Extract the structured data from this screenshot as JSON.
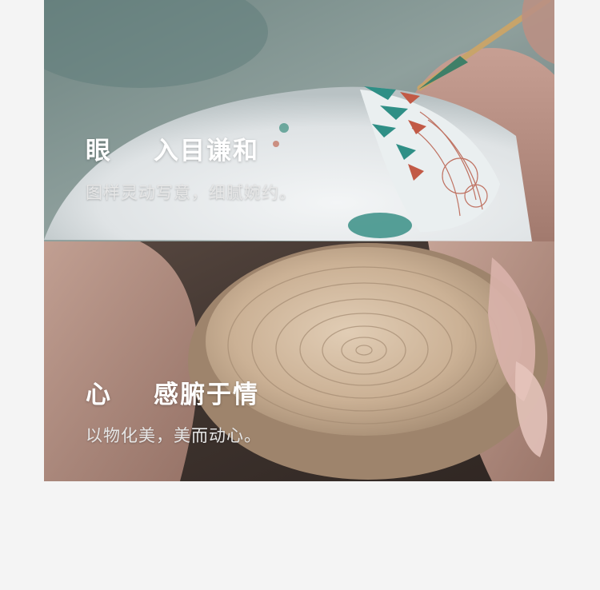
{
  "sections": [
    {
      "heading_char": "眼",
      "heading_phrase": "入目谦和",
      "caption": "图样灵动写意，细腻婉约。",
      "photo_icon": "porcelain-bowl-brush-painting"
    },
    {
      "heading_char": "心",
      "heading_phrase": "感腑于情",
      "caption": "以物化美，美而动心。",
      "photo_icon": "clay-bowl-on-wheel"
    }
  ],
  "colors": {
    "page_background": "#f4f4f4",
    "heading_text": "#ffffff",
    "caption_text": "#e6e6e6"
  }
}
